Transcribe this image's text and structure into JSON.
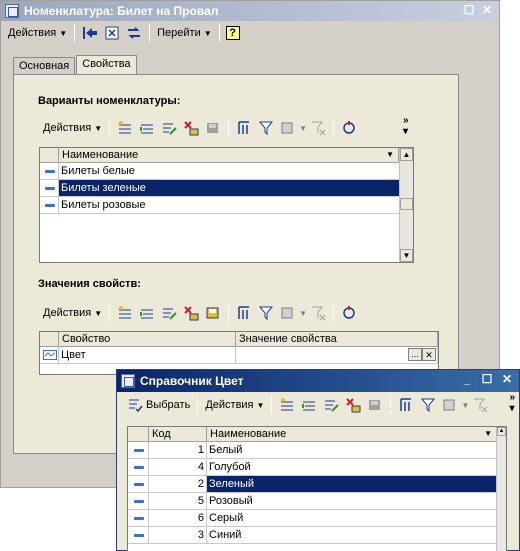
{
  "main_window": {
    "title": "Номенклатура: Билет на Провал",
    "toolbar": {
      "actions_label": "Действия",
      "goto_label": "Перейти",
      "help_label": "?"
    },
    "tabs": [
      {
        "label": "Основная"
      },
      {
        "label": "Свойства"
      }
    ],
    "variants": {
      "section_label": "Варианты номенклатуры:",
      "toolbar_actions_label": "Действия",
      "header_name": "Наименование",
      "rows": [
        {
          "name": "Билеты белые"
        },
        {
          "name": "Билеты зеленые"
        },
        {
          "name": "Билеты розовые"
        }
      ]
    },
    "properties": {
      "section_label": "Значения свойств:",
      "toolbar_actions_label": "Действия",
      "header_property": "Свойство",
      "header_value": "Значение свойства",
      "rows": [
        {
          "property": "Цвет",
          "value": ""
        }
      ],
      "ellipsis": "...",
      "clear": "✕"
    }
  },
  "child_window": {
    "title": "Справочник Цвет",
    "toolbar": {
      "select_label": "Выбрать",
      "actions_label": "Действия"
    },
    "header_code": "Код",
    "header_name": "Наименование",
    "rows": [
      {
        "code": "1",
        "name": "Белый"
      },
      {
        "code": "4",
        "name": "Голубой"
      },
      {
        "code": "2",
        "name": "Зеленый"
      },
      {
        "code": "5",
        "name": "Розовый"
      },
      {
        "code": "6",
        "name": "Серый"
      },
      {
        "code": "3",
        "name": "Синий"
      }
    ]
  },
  "colors": {
    "selection": "#0a246a",
    "title_active": "#0a246a",
    "title_inactive": "#9aa7c0"
  }
}
